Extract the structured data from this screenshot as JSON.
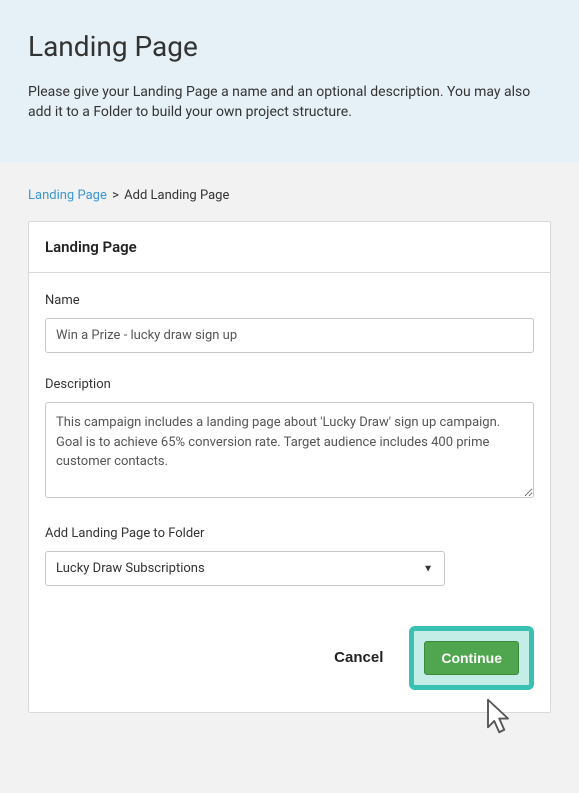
{
  "header": {
    "title": "Landing Page",
    "subtitle": "Please give your Landing Page a name and an optional description. You may also add it to a Folder to build your own project structure."
  },
  "breadcrumb": {
    "link_text": "Landing Page",
    "current": "Add Landing Page"
  },
  "panel": {
    "title": "Landing Page"
  },
  "form": {
    "name_label": "Name",
    "name_value": "Win a Prize - lucky draw sign up",
    "description_label": "Description",
    "description_value": "This campaign includes a landing page about 'Lucky Draw' sign up campaign. Goal is to achieve 65% conversion rate. Target audience includes 400 prime customer contacts.",
    "folder_label": "Add Landing Page to Folder",
    "folder_value": "Lucky Draw Subscriptions"
  },
  "buttons": {
    "cancel": "Cancel",
    "continue": "Continue"
  }
}
